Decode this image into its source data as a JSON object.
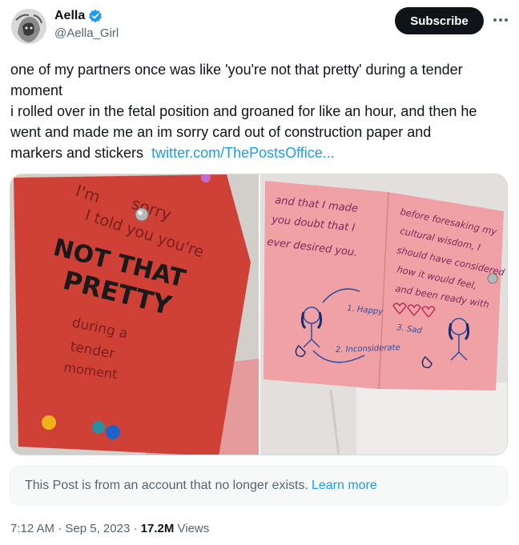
{
  "author": {
    "display_name": "Aella",
    "handle": "@Aella_Girl",
    "verified": true,
    "avatar_icon": "avatar-image"
  },
  "actions": {
    "subscribe_label": "Subscribe",
    "more_icon": "more-dots-icon"
  },
  "post": {
    "lines": [
      "one of my partners once was like 'you're not that pretty' during a tender",
      "moment",
      "i rolled over in the fetal position and groaned for like an hour, and then he",
      "went and made me an im sorry card out of construction paper and"
    ],
    "last_line_text": "markers and stickers",
    "link_text": "twitter.com/ThePostsOffice..."
  },
  "media": {
    "left_card": {
      "lines": [
        "I'm",
        "sorry",
        "I told you you're",
        "NOT THAT",
        "PRETTY",
        "during a",
        "tender",
        "moment"
      ]
    },
    "right_card": {
      "left_lines": [
        "and that I made",
        "you doubt that I",
        "ever desired you."
      ],
      "right_lines": [
        "before foresaking my",
        "cultural wisdom, I",
        "should have considered",
        "how it would feel,",
        "and been ready with"
      ],
      "labels": [
        "1. Happy",
        "2. Inconsiderate",
        "3. Sad"
      ]
    }
  },
  "notice": {
    "text": "This Post is from an account that no longer exists.",
    "link": "Learn more"
  },
  "meta": {
    "time": "7:12 AM",
    "separator": " · ",
    "date": "Sep 5, 2023",
    "views_count": "17.2M",
    "views_label": " Views"
  },
  "colors": {
    "accent": "#1d9bf0",
    "text": "#0f1419",
    "muted": "#536471",
    "button_bg": "#0f1419",
    "red_card": "#cf3f38",
    "pink_card": "#f0a0a6"
  }
}
